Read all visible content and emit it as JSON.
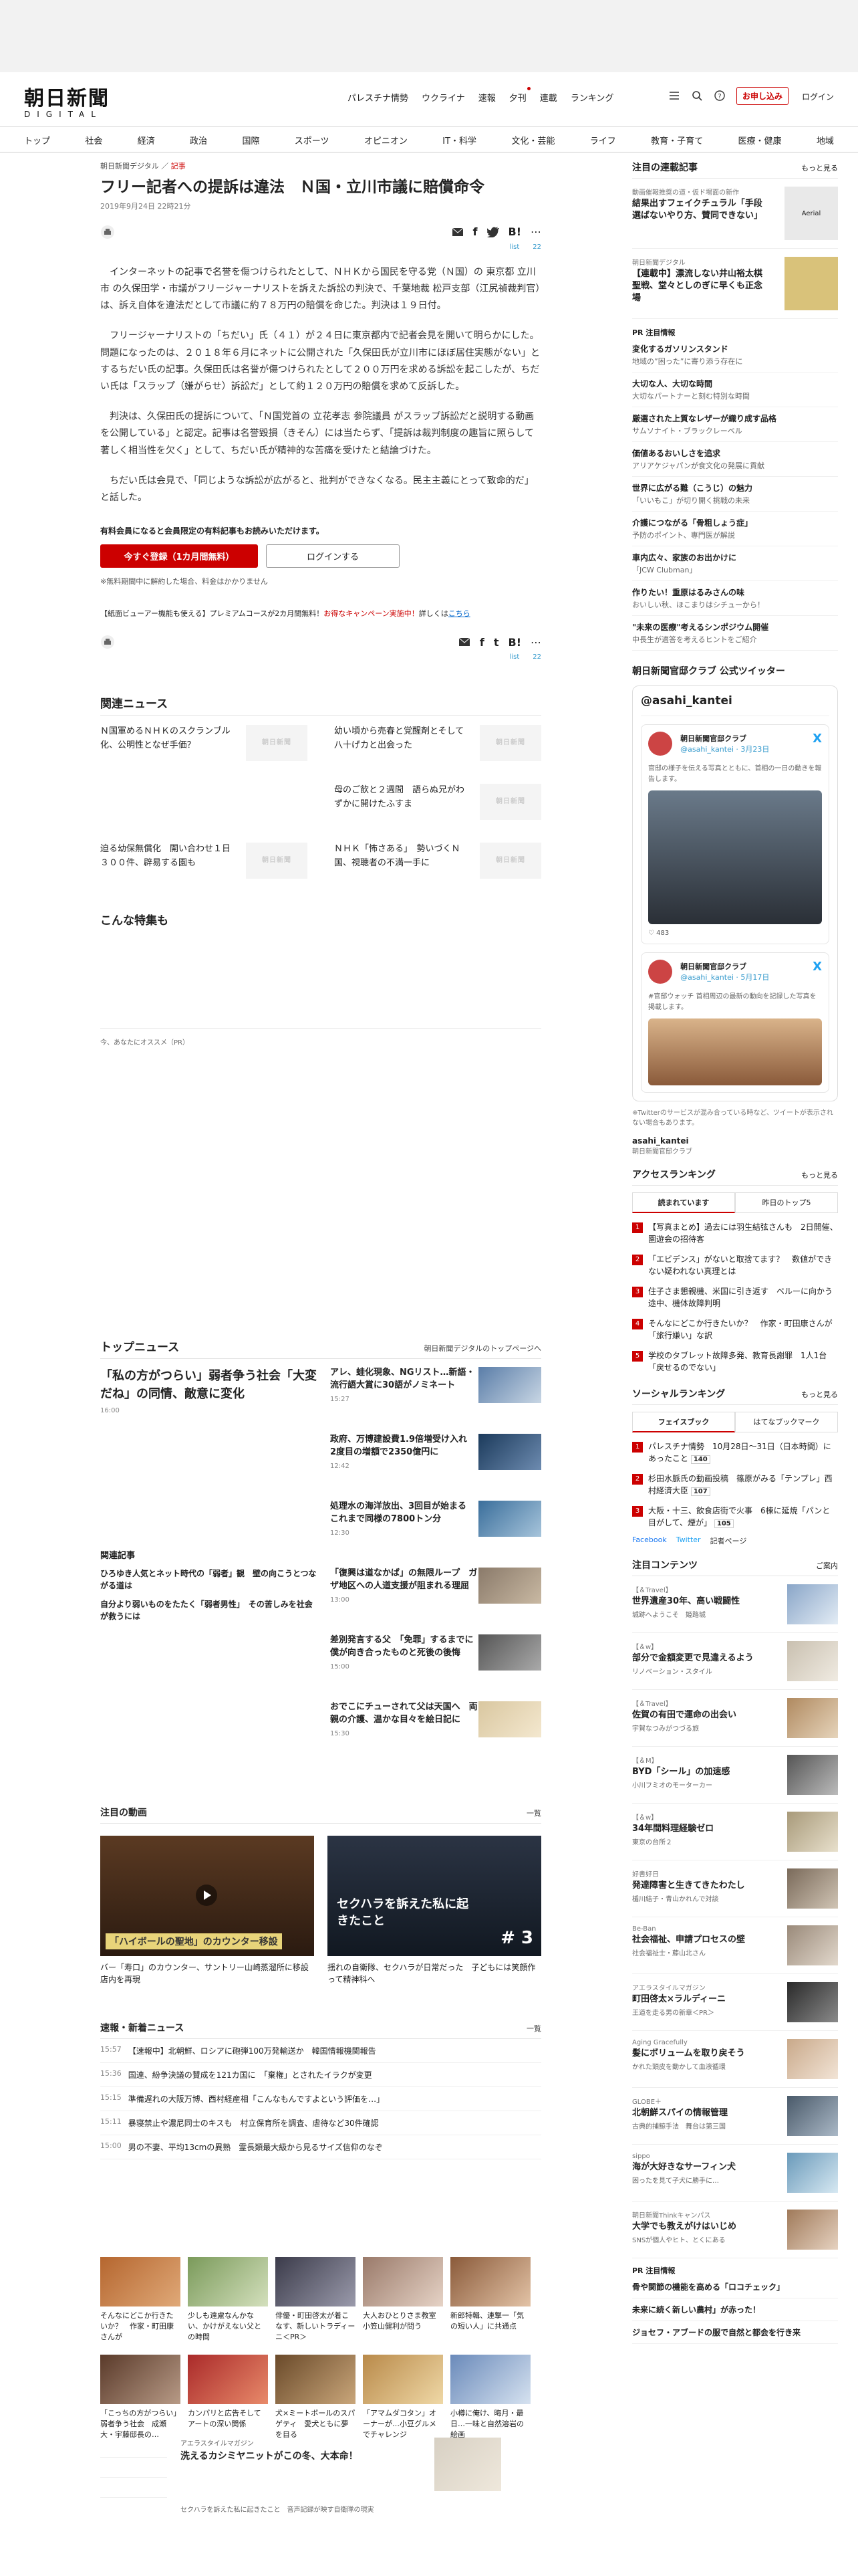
{
  "header": {
    "logo_main": "朝日新聞",
    "logo_sub": "DIGITAL",
    "nav": [
      "パレスチナ情勢",
      "ウクライナ",
      "速報",
      "夕刊",
      "連載",
      "ランキング"
    ],
    "register": "お申し込み",
    "login": "ログイン"
  },
  "gnav": [
    "トップ",
    "社会",
    "経済",
    "政治",
    "国際",
    "スポーツ",
    "オピニオン",
    "IT・科学",
    "文化・芸能",
    "ライフ",
    "教育・子育て",
    "医療・健康",
    "地域"
  ],
  "article": {
    "breadcrumb_site": "朝日新聞デジタル",
    "breadcrumb_cat": "記事",
    "title": "フリー記者への提訴は違法　Ｎ国・立川市議に賠償命令",
    "date": "2019年9月24日 22時21分",
    "share_count_a": "list",
    "share_count_b": "22",
    "paragraphs": [
      "インターネットの記事で名誉を傷つけられたとして、ＮＨＫから国民を守る党（Ｎ国）の 東京都 立川市 の久保田学・市議がフリージャーナリストを訴えた訴訟の判決で、千葉地裁 松戸支部（江尻禎裁判官）は、訴え自体を違法だとして市議に約７８万円の賠償を命じた。判決は１９日付。",
      "フリージャーナリストの「ちだい」氏（４１）が２４日に東京都内で記者会見を開いて明らかにした。問題になったのは、２０１８年６月にネットに公開された「久保田氏が立川市にほぼ居住実態がない」とするちだい氏の記事。久保田氏は名誉が傷つけられたとして２００万円を求める訴訟を起こしたが、ちだい氏は「スラップ（嫌がらせ）訴訟だ」として約１２０万円の賠償を求めて反訴した。",
      "判決は、久保田氏の提訴について、「Ｎ国党首の 立花孝志 参院議員 がスラップ訴訟だと説明する動画を公開している」と認定。記事は名誉毀損（きそん）には当たらず、「提訴は裁判制度の趣旨に照らして著しく相当性を欠く」として、ちだい氏が精神的な苦痛を受けたと結論づけた。",
      "ちだい氏は会見で、「同じような訴訟が広がると、批判ができなくなる。民主主義にとって致命的だ」と話した。"
    ],
    "pay_title": "有料会員になると会員限定の有料記事もお読みいただけます。",
    "pay_btn": "今すぐ登録（1カ月間無料）",
    "login_btn": "ログインする",
    "pay_note": "※無料期間中に解約した場合、料金はかかりません",
    "promo_a": "【紙面ビューアー機能も使える】プレミアムコースが2カ月間無料！",
    "promo_b": "お得なキャンペーン実施中！",
    "promo_c": "詳しくは",
    "promo_link": "こちら"
  },
  "related": {
    "title": "関連ニュース",
    "items": [
      "Ｎ国軍めるＮＨＫのスクランブル化、公明性となぜ手価？",
      "幼い頃から売春と覚醒剤とそして八十げカと出会った",
      "",
      "母のご飲と２週間　語らぬ兄がわずかに開けたふすま",
      "迫る幼保無償化　開い合わせ１日３００件、辟易する園も",
      "ＮＨＫ「怖さある」　勢いづくＮ国、視聴者の不満一手に"
    ],
    "thumb_text": "朝日新聞"
  },
  "special": {
    "title": "こんな特集も",
    "pr": "今、あなたにオススメ（PR）"
  },
  "topnews": {
    "title": "トップニュース",
    "more": "朝日新聞デジタルのトップページへ",
    "lead": "「私の方がつらい」弱者争う社会「大変だね」の同情、敵意に変化",
    "lead_time": "16:00",
    "related_title": "関連記事",
    "related_items": [
      "ひろゆき人気とネット時代の「弱者」観　壁の向こうとつながる道は",
      "自分より弱いものをたたく「弱者男性」　その苦しみを社会が救うには"
    ],
    "right": [
      {
        "t": "アレ、蛙化現象、NGリスト…新語・流行語大賞に30語がノミネート",
        "tm": "15:27"
      },
      {
        "t": "政府、万博建設費1.9倍増受け入れ　2度目の増額で2350億円に",
        "tm": "12:42"
      },
      {
        "t": "処理水の海洋放出、3回目が始まる　これまで同様の7800トン分",
        "tm": "12:30"
      },
      {
        "t": "「復興は道なかば」の無限ループ　ガザ地区への人道支援が阻まれる理屈",
        "tm": "13:00"
      },
      {
        "t": "差別発言する父　「免罪」するまでに僕が向き合ったものと死後の後悔",
        "tm": "15:00"
      },
      {
        "t": "おでこにチューされて父は天国へ　両親の介護、温かな目々を絵日記に",
        "tm": "15:30"
      }
    ]
  },
  "videos": {
    "title": "注目の動画",
    "more": "一覧",
    "items": [
      {
        "cap": "バー「寿口」のカウンター、サントリー山崎蒸溜所に移設　店内を再現",
        "overlay": "「ハイボールの聖地」のカウンター移設"
      },
      {
        "cap": "揺れの自衛隊、セクハラが日常だった　子どもには笑顔作って精神科へ",
        "overlay": "セクハラを訴えた私に起きたこと",
        "num": "# 3"
      }
    ]
  },
  "breaking": {
    "title": "速報・新着ニュース",
    "more": "一覧",
    "items": [
      {
        "tm": "15:57",
        "t": "【速報中】北朝鮮、ロシアに砲弾100万発輸送か　韓国情報機関報告"
      },
      {
        "tm": "15:36",
        "t": "国連、紛争決議の賛成を121カ国に　「棄権」とされたイラクが変更"
      },
      {
        "tm": "15:15",
        "t": "準備遅れの大阪万博、西村経産相「こんなもんですよという評価を…」"
      },
      {
        "tm": "15:11",
        "t": "暴寝禁止や濃尼同士のキスも　村立保育所を調査、虐待など30件確認"
      },
      {
        "tm": "15:00",
        "t": "男の不妻、平均13cmの異熟　霊長類最大級から見るサイズ信仰のなぞ"
      }
    ]
  },
  "grid": [
    "そんなにどこか行きたいか？　作家・町田康さんが",
    "少しも遠慮なんかない、かけがえない父との時間",
    "俳優・町田啓太が着こなす、新しいトラディーニ＜PR＞",
    "大人おひとりさま教室　小笠山健利が問う",
    "新郎特輯、連撃一「気の短い人」に共通点",
    "「こっちの方がつらい」弱者争う社会　成瀬大・宇藤邸長の…",
    "カンパリと広告そしてアートの深い関係",
    "犬×ミートボールのスパゲティ　愛犬ともに夢を目る",
    "「アマムダコタン」オーナーが…小豆グルメでチャレンジ",
    "小樽に俺け、晦月・最日…一味と自然溶岩の絵画"
  ],
  "banner": {
    "sub": "アエラスタイルマガジン",
    "t": "洗えるカシミヤニットがこの冬、大本命！",
    "sub2": "セクハラを訴えた私に起きたこと　音声記録が映す自衛隊の現実"
  },
  "side": {
    "features_title": "注目の連載記事",
    "features_more": "もっと見る",
    "features": [
      {
        "s": "動画催報推奨の道・仮ド場面の新作",
        "t": "結果出すフェイクチュラル「手段選ばないやり方、賛同できない」",
        "badge": "Aerial"
      },
      {
        "s": "朝日新聞デジタル",
        "t": "【連載中】漂流しない井山裕太棋聖戦、堂々としのぎに早くも正念場"
      }
    ],
    "pr_title": "PR 注目情報",
    "pr": [
      {
        "a": "変化するガソリンスタンド",
        "b": "地域の”困った”に寄り添う存在に"
      },
      {
        "a": "大切な人、大切な時間",
        "b": "大切なパートナーと刻む特別な時間"
      },
      {
        "a": "厳選された上質なレザーが織り成す品格",
        "b": "サムソナイト・ブラックレーベル"
      },
      {
        "a": "価値あるおいしさを追求",
        "b": "アリアケジャパンが食文化の発展に貢献"
      },
      {
        "a": "世界に広がる難（こうじ）の魅力",
        "b": "「いいもこ」が切り開く挑戦の未来"
      },
      {
        "a": "介護につながる「骨粗しょう症」",
        "b": "予防のポイント、専門医が解説"
      },
      {
        "a": "車内広々、家族のお出かけに",
        "b": "「JCW Clubman」"
      },
      {
        "a": "作りたい！重原はるみさんの味",
        "b": "おいしい秋、ほこまりはシチューから！"
      },
      {
        "a": "\"未来の医療\"考えるシンポジウム開催",
        "b": "中長生が適答を考えるヒントをご紹介"
      }
    ],
    "twitter_title": "朝日新聞官邸クラブ 公式ツイッター",
    "tw_head": "@asahi_kantei",
    "tw_name": "朝日新聞官邸クラブ",
    "tw_handle1": "@asahi_kantei · 3月23日",
    "tw_handle2": "@asahi_kantei · 5月17日",
    "tw_text1": "官邸の様子を伝える写真とともに、首相の一日の動きを報告します。",
    "tw_text2": "#官邸ウォッチ 首相周辺の最新の動向を記録した写真を掲載します。",
    "tw_likes": "483",
    "tw_note": "※Twitterのサービスが混み合っている時など、ツイートが表示されない場合もあります。",
    "tw_acc": "asahi_kantei",
    "tw_acc_sub": "朝日新聞官邸クラブ",
    "access_title": "アクセスランキング",
    "access_more": "もっと見る",
    "tab1": "読まれています",
    "tab2": "昨日のトップ5",
    "access": [
      "【写真まとめ】過去には羽生結弦さんも　2日開催、園遊会の招待客",
      "「エビデンス」がないと取捨てます？　数値ができない疑われない真理とは",
      "住子さま懇親機、米国に引き返す　ベルーに向かう途中、機体故障判明",
      "そんなにどこか行きたいか？　作家・町田康さんが「旅行嫌い」な訳",
      "学校のタブレット故障多発、教育長謝罪　1人1台「戻せるのでない」"
    ],
    "social_title": "ソーシャルランキング",
    "social_more": "もっと見る",
    "stab1": "フェイスブック",
    "stab2": "はてなブックマーク",
    "social": [
      {
        "t": "パレスチナ情勢　10月28日〜31日（日本時間）にあったこと",
        "c": "140"
      },
      {
        "t": "杉田水脈氏の動画投稿　篠原がみる「テンプレ」西村経済大臣",
        "c": "107"
      },
      {
        "t": "大阪・十三、飲食店街で火事　6棟に延焼「パンと目がして、煙が」",
        "c": "105"
      }
    ],
    "sns_fb": "Facebook",
    "sns_tw": "Twitter",
    "sns_more": "記者ページ",
    "content_title": "注目コンテンツ",
    "content_more": "ご案内",
    "content": [
      {
        "s": "【＆Travel】",
        "t": "世界遺産30年、高い戦闘性",
        "d": "城跡へようこそ　姫路城"
      },
      {
        "s": "【＆w】",
        "t": "部分で金額変更で見違えるよう",
        "d": "リノベーション・スタイル"
      },
      {
        "s": "【＆Travel】",
        "t": "佐賀の有田で運命の出会い",
        "d": "宇賀なつみがつづる旅"
      },
      {
        "s": "【＆M】",
        "t": "BYD「シール」の加速感",
        "d": "小川フミオのモーターカー"
      },
      {
        "s": "【＆w】",
        "t": "34年間料理経験ゼロ",
        "d": "東京の台所２"
      },
      {
        "s": "好書好日",
        "t": "発達障害と生きてきたわたし",
        "d": "楯川結子・青山かれんで対談"
      },
      {
        "s": "Be-Ban",
        "t": "社会福祉、申請プロセスの壁",
        "d": "社会福祉士・藤山北さん"
      },
      {
        "s": "アエラスタイルマガジン",
        "t": "町田啓太×ラルディーニ",
        "d": "王道を走る男の新章＜PR＞"
      },
      {
        "s": "Aging Gracefully",
        "t": "髪にボリュームを取り戻そう",
        "d": "かれた頭皮を動かして血液循環"
      },
      {
        "s": "GLOBE＋",
        "t": "北朝鮮スパイの情報管理",
        "d": "古典的捕鯨手法　舞台は第三国"
      },
      {
        "s": "sippo",
        "t": "海が大好きなサーフィン犬",
        "d": "困ったを見て子犬に勝手に…"
      },
      {
        "s": "朝日新聞Thinkキャンパス",
        "t": "大学でも教えがけはいじめ",
        "d": "SNSが個人やヒト、とくにある"
      }
    ],
    "pr2_title": "PR 注目情報",
    "pr2": [
      "骨や関節の機能を高める「ロコチェック」",
      "未来に続く新しい農村」が赤った！",
      "ジョセフ・アブードの服で自然と都会を行き来"
    ]
  }
}
